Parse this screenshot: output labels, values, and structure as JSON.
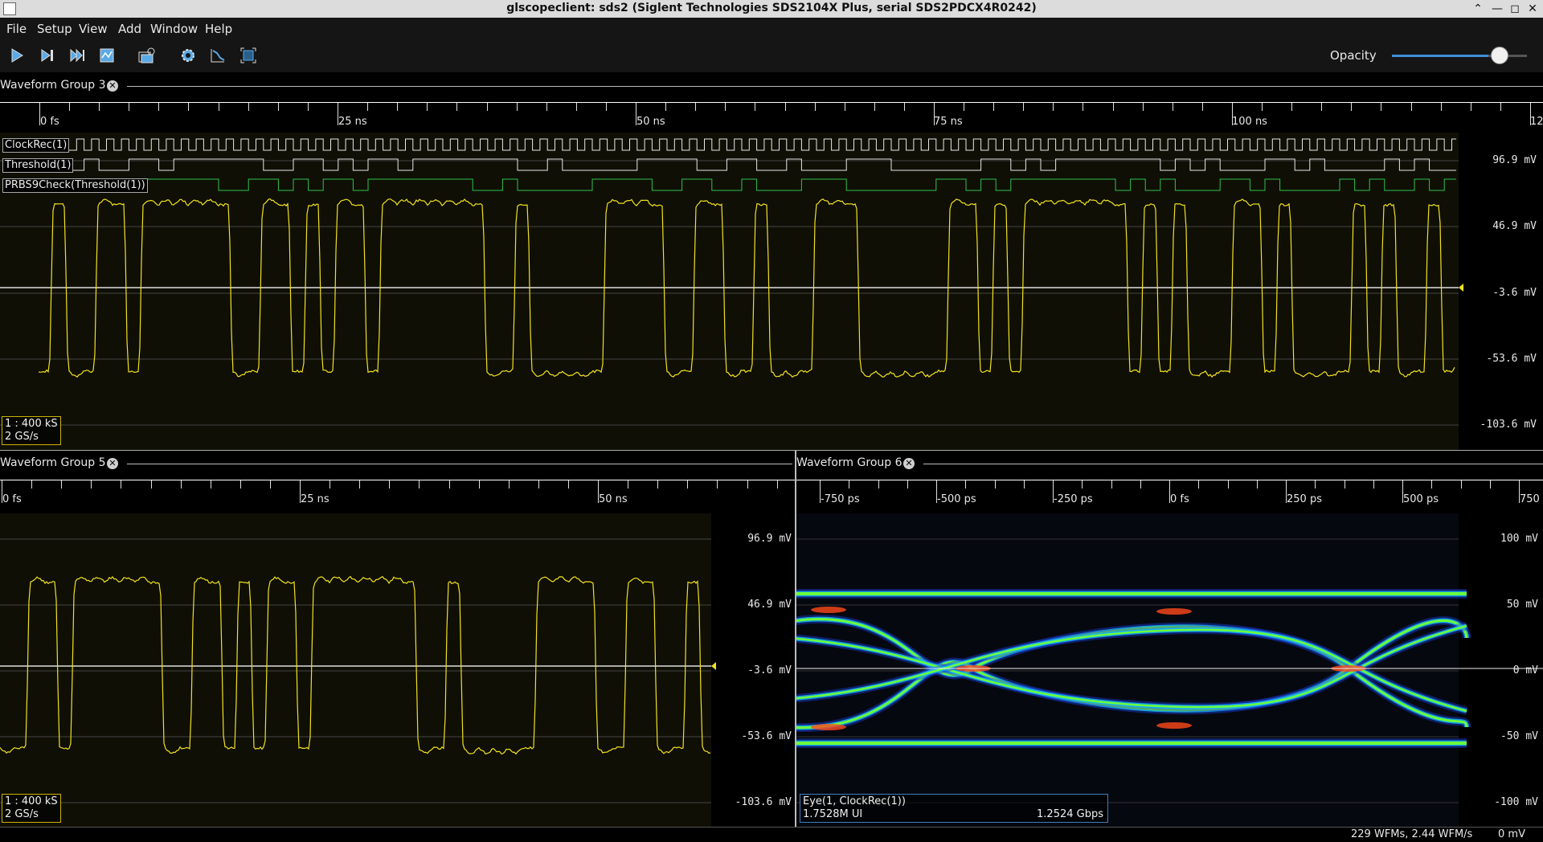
{
  "window": {
    "title": "glscopeclient: sds2 (Siglent Technologies SDS2104X Plus, serial SDS2PDCX4R0242)"
  },
  "menu": {
    "items": [
      "File",
      "Setup",
      "View",
      "Add",
      "Window",
      "Help"
    ]
  },
  "toolbar": {
    "buttons": [
      {
        "name": "start-trigger-button",
        "icon": "play-icon"
      },
      {
        "name": "single-trigger-button",
        "icon": "step-icon"
      },
      {
        "name": "force-trigger-button",
        "icon": "skip-icon"
      },
      {
        "name": "stop-trigger-button",
        "icon": "stop-icon"
      },
      {
        "name": "history-button",
        "icon": "history-icon"
      },
      {
        "name": "refresh-button",
        "icon": "gear-icon"
      },
      {
        "name": "autoscale-button",
        "icon": "graph-icon"
      },
      {
        "name": "fullscreen-button",
        "icon": "fullscreen-icon"
      }
    ],
    "opacity_label": "Opacity",
    "opacity_value": 0.79
  },
  "groups": {
    "g3": {
      "name": "Waveform Group 3",
      "ticks": [
        "0 fs",
        "25 ns",
        "50 ns",
        "75 ns",
        "100 ns",
        "12"
      ],
      "vlabels": [
        "96.9 mV",
        "46.9 mV",
        "-3.6 mV",
        "-53.6 mV",
        "-103.6 mV"
      ],
      "digital": [
        "ClockRec(1)",
        "Threshold(1)",
        "PRBS9Check(Threshold(1))"
      ],
      "info": [
        "1 : 400 kS",
        "2 GS/s"
      ]
    },
    "g5": {
      "name": "Waveform Group 5",
      "ticks": [
        "0 fs",
        "25 ns",
        "50 ns"
      ],
      "vlabels": [
        "96.9 mV",
        "46.9 mV",
        "-3.6 mV",
        "-53.6 mV",
        "-103.6 mV"
      ],
      "info": [
        "1 : 400 kS",
        "2 GS/s"
      ]
    },
    "g6": {
      "name": "Waveform Group 6",
      "ticks": [
        "-750 ps",
        "-500 ps",
        "-250 ps",
        "0 fs",
        "250 ps",
        "500 ps",
        "750"
      ],
      "vlabels": [
        "100 mV",
        "50 mV",
        "0 mV",
        "-50 mV",
        "-100 mV"
      ],
      "eye_title": "Eye(1, ClockRec(1))",
      "eye_ui": "1.7528M UI",
      "eye_rate": "1.2524 Gbps"
    }
  },
  "status": {
    "wfms": "229 WFMs, 2.44 WFM/s",
    "value": "0 mV"
  },
  "colors": {
    "analog": "#f2e21e",
    "digital_clock": "#e8e8e8",
    "digital_prbs": "#2fc24a",
    "panel_bg": "#0f0f06"
  }
}
